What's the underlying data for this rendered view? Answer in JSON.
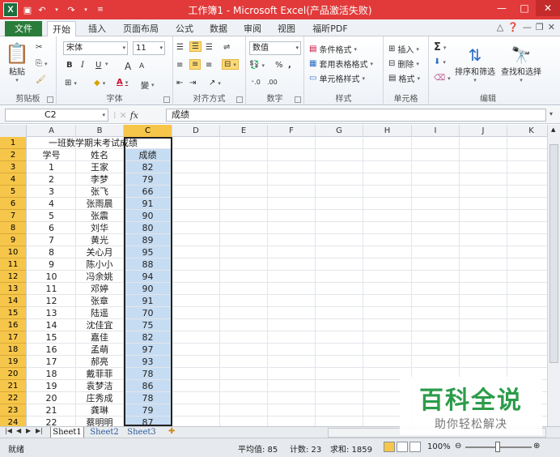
{
  "window": {
    "title": "工作簿1 - Microsoft Excel(产品激活失败)",
    "app_icon": "X",
    "controls": {
      "minimize": "—",
      "maximize": "□",
      "close": "✕"
    }
  },
  "ribbon_tabs": {
    "file": "文件",
    "tabs": [
      "开始",
      "插入",
      "页面布局",
      "公式",
      "数据",
      "审阅",
      "视图",
      "福昕PDF"
    ],
    "active": "开始"
  },
  "ribbon": {
    "clipboard": {
      "paste": "粘贴",
      "group": "剪贴板"
    },
    "font": {
      "name": "宋体",
      "size": "11",
      "bold": "B",
      "italic": "I",
      "underline": "U",
      "grow": "A",
      "shrink": "A",
      "wen": "變",
      "group": "字体"
    },
    "alignment": {
      "group": "对齐方式"
    },
    "number": {
      "format": "数值",
      "percent": "%",
      "comma": ",",
      "group": "数字"
    },
    "styles": {
      "conditional": "条件格式",
      "table": "套用表格格式",
      "cell": "单元格样式",
      "group": "样式"
    },
    "cells": {
      "insert": "插入",
      "delete": "删除",
      "format": "格式",
      "group": "单元格"
    },
    "editing": {
      "sum": "Σ",
      "sort": "排序和筛选",
      "find": "查找和选择",
      "group": "编辑"
    }
  },
  "formula_bar": {
    "name_box": "C2",
    "fx": "fx",
    "value": "成绩"
  },
  "columns": [
    "A",
    "B",
    "C",
    "D",
    "E",
    "F",
    "G",
    "H",
    "I",
    "J",
    "K"
  ],
  "selected_column": "C",
  "sheet": {
    "title": "一班数学期末考试成绩",
    "header": {
      "a": "学号",
      "b": "姓名",
      "c": "成绩"
    },
    "rows": [
      {
        "a": "1",
        "b": "王家",
        "c": "82"
      },
      {
        "a": "2",
        "b": "李梦",
        "c": "79"
      },
      {
        "a": "3",
        "b": "张飞",
        "c": "66"
      },
      {
        "a": "4",
        "b": "张雨晨",
        "c": "91"
      },
      {
        "a": "5",
        "b": "张震",
        "c": "90"
      },
      {
        "a": "6",
        "b": "刘华",
        "c": "80"
      },
      {
        "a": "7",
        "b": "黄光",
        "c": "89"
      },
      {
        "a": "8",
        "b": "关心月",
        "c": "95"
      },
      {
        "a": "9",
        "b": "陈小小",
        "c": "88"
      },
      {
        "a": "10",
        "b": "冯余姚",
        "c": "94"
      },
      {
        "a": "11",
        "b": "邓婷",
        "c": "90"
      },
      {
        "a": "12",
        "b": "张章",
        "c": "91"
      },
      {
        "a": "13",
        "b": "陆遥",
        "c": "70"
      },
      {
        "a": "14",
        "b": "沈佳宜",
        "c": "75"
      },
      {
        "a": "15",
        "b": "嘉佳",
        "c": "82"
      },
      {
        "a": "16",
        "b": "孟萌",
        "c": "97"
      },
      {
        "a": "17",
        "b": "郝亮",
        "c": "93"
      },
      {
        "a": "18",
        "b": "戴菲菲",
        "c": "78"
      },
      {
        "a": "19",
        "b": "袁梦洁",
        "c": "86"
      },
      {
        "a": "20",
        "b": "庄秀成",
        "c": "78"
      },
      {
        "a": "21",
        "b": "龚琳",
        "c": "79"
      },
      {
        "a": "22",
        "b": "蔡明明",
        "c": "87"
      }
    ]
  },
  "row_numbers": [
    "1",
    "2",
    "3",
    "4",
    "5",
    "6",
    "7",
    "8",
    "9",
    "10",
    "11",
    "12",
    "13",
    "14",
    "15",
    "16",
    "17",
    "18",
    "19",
    "20",
    "21",
    "22",
    "23",
    "24"
  ],
  "sheet_tabs": [
    "Sheet1",
    "Sheet2",
    "Sheet3"
  ],
  "active_sheet": "Sheet1",
  "status": {
    "mode": "就绪",
    "average": "平均值: 85",
    "count": "计数: 23",
    "sum": "求和: 1859",
    "zoom": "100%"
  },
  "watermark": {
    "title": "百科全说",
    "subtitle": "助你轻松解决"
  },
  "colors": {
    "title_bar": "#e23a3a",
    "file_tab": "#2a7c3a",
    "selection_fill": "#c6dcf2",
    "header_highlight": "#f6c64a",
    "watermark_green": "#2c9c4a"
  }
}
